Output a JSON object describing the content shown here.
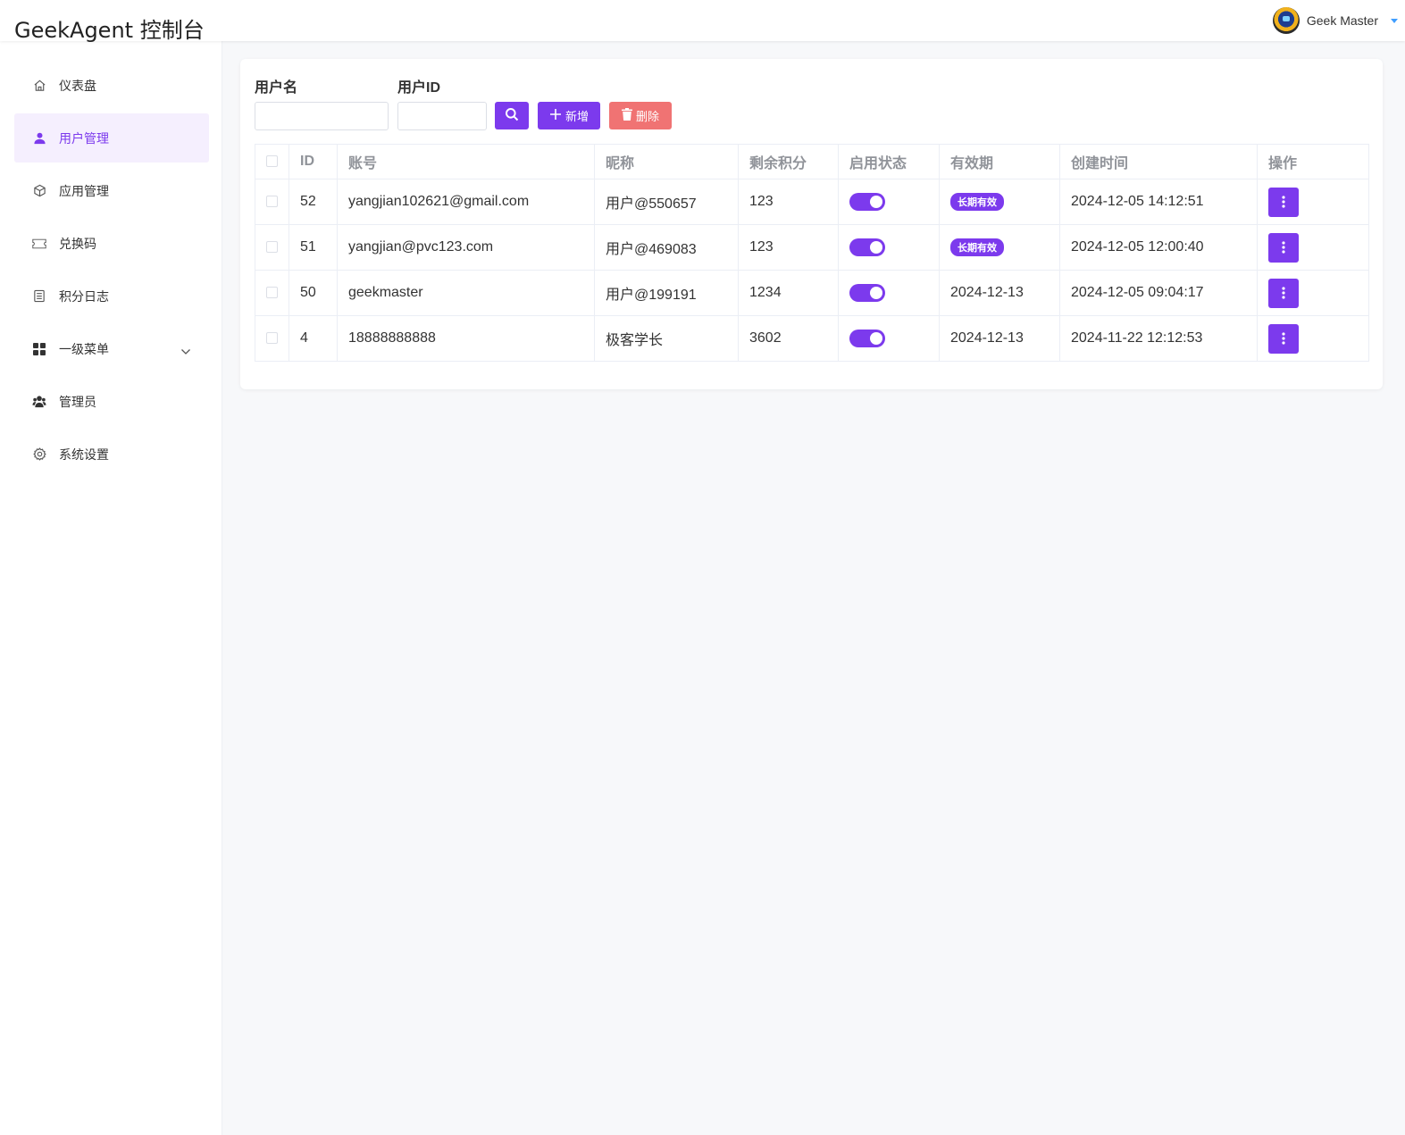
{
  "app": {
    "title": "GeekAgent 控制台"
  },
  "header": {
    "user_name": "Geek Master"
  },
  "sidebar": {
    "items": [
      {
        "label": "仪表盘",
        "icon": "home-icon",
        "active": false
      },
      {
        "label": "用户管理",
        "icon": "user-icon",
        "active": true
      },
      {
        "label": "应用管理",
        "icon": "cube-icon",
        "active": false
      },
      {
        "label": "兑换码",
        "icon": "ticket-icon",
        "active": false
      },
      {
        "label": "积分日志",
        "icon": "log-icon",
        "active": false
      },
      {
        "label": "一级菜单",
        "icon": "grid-icon",
        "active": false,
        "expandable": true
      },
      {
        "label": "管理员",
        "icon": "admin-icon",
        "active": false
      },
      {
        "label": "系统设置",
        "icon": "gear-icon",
        "active": false
      }
    ]
  },
  "filters": {
    "username_label": "用户名",
    "userid_label": "用户ID",
    "username_value": "",
    "userid_value": "",
    "add_label": "新增",
    "delete_label": "删除"
  },
  "table": {
    "headers": [
      "ID",
      "账号",
      "昵称",
      "剩余积分",
      "启用状态",
      "有效期",
      "创建时间",
      "操作"
    ],
    "rows": [
      {
        "id": "52",
        "account": "yangjian102621@gmail.com",
        "nickname": "用户@550657",
        "points": "123",
        "enabled": true,
        "expiry": "长期有效",
        "expiry_is_tag": true,
        "created": "2024-12-05 14:12:51"
      },
      {
        "id": "51",
        "account": "yangjian@pvc123.com",
        "nickname": "用户@469083",
        "points": "123",
        "enabled": true,
        "expiry": "长期有效",
        "expiry_is_tag": true,
        "created": "2024-12-05 12:00:40"
      },
      {
        "id": "50",
        "account": "geekmaster",
        "nickname": "用户@199191",
        "points": "1234",
        "enabled": true,
        "expiry": "2024-12-13",
        "expiry_is_tag": false,
        "created": "2024-12-05 09:04:17"
      },
      {
        "id": "4",
        "account": "18888888888",
        "nickname": "极客学长",
        "points": "3602",
        "enabled": true,
        "expiry": "2024-12-13",
        "expiry_is_tag": false,
        "created": "2024-11-22 12:12:53"
      }
    ]
  },
  "colors": {
    "primary": "#7c3aed",
    "danger": "#f07373",
    "active_bg": "#f5effe"
  }
}
